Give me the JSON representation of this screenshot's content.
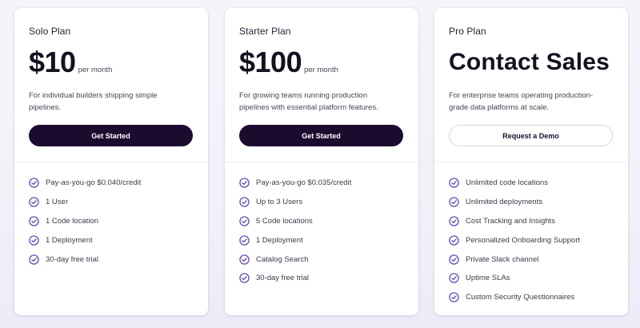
{
  "colors": {
    "accent": "#5b3fb0",
    "button_dark": "#1c0b2e",
    "background": "#f4f1fa"
  },
  "plans": [
    {
      "name": "Solo Plan",
      "price": "$10",
      "period": "per month",
      "description": "For individual builders shipping simple pipelines.",
      "button_label": "Get Started",
      "features": [
        "Pay-as-you-go $0.040/credit",
        "1 User",
        "1 Code location",
        "1 Deployment",
        "30-day free trial"
      ]
    },
    {
      "name": "Starter Plan",
      "price": "$100",
      "period": "per month",
      "description": "For growing teams running production pipelines with essential platform features.",
      "button_label": "Get Started",
      "features": [
        "Pay-as-you-go $0.035/credit",
        "Up to 3 Users",
        "5 Code locations",
        "1 Deployment",
        "Catalog Search",
        "30-day free trial"
      ]
    },
    {
      "name": "Pro Plan",
      "price": "Contact Sales",
      "description": "For enterprise teams operating production-grade data platforms at scale.",
      "button_label": "Request a Demo",
      "features": [
        "Unlimited code locations",
        "Unlimited deployments",
        "Cost Tracking and Insights",
        "Personalized Onboarding Support",
        "Private Slack channel",
        "Uptime SLAs",
        "Custom Security Questionnaires"
      ]
    }
  ],
  "icons": {
    "feature_check": "check-circle-icon"
  }
}
